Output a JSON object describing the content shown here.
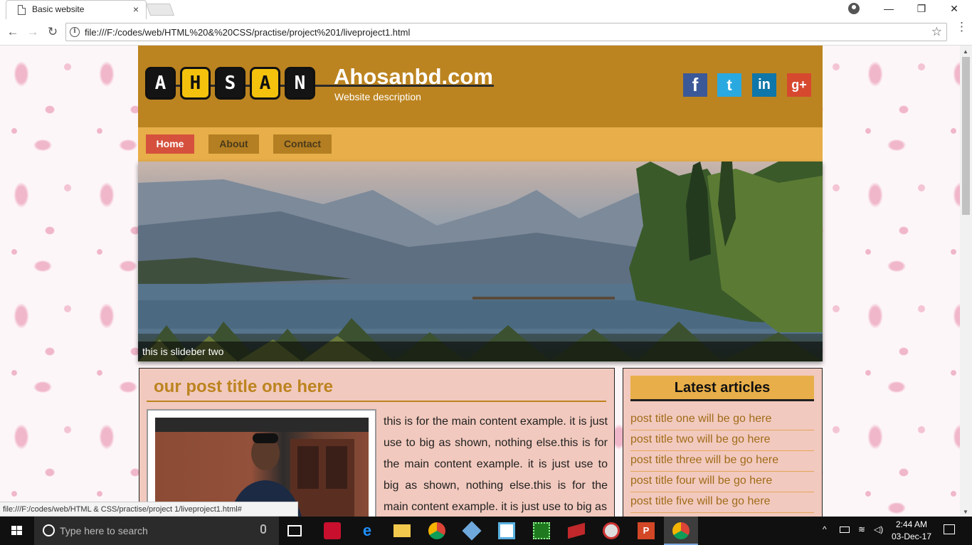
{
  "browser": {
    "tab_title": "Basic website",
    "tab_close": "×",
    "url": "file:///F:/codes/web/HTML%20&%20CSS/practise/project%201/liveproject1.html",
    "status_url": "file:///F:/codes/web/HTML & CSS/practise/project 1/liveproject1.html#",
    "info_glyph": "i",
    "back_glyph": "←",
    "forward_glyph": "→",
    "reload_glyph": "↻",
    "star_glyph": "☆",
    "menu_glyph": "⋮",
    "minimize_glyph": "—",
    "maximize_glyph": "❐",
    "close_glyph": "✕"
  },
  "site": {
    "logo_letters": [
      "A",
      "H",
      "S",
      "A",
      "N"
    ],
    "title": "Ahosanbd.com",
    "description": "Website description",
    "social": [
      {
        "name": "facebook-icon",
        "glyph": "f"
      },
      {
        "name": "twitter-icon",
        "glyph": "t"
      },
      {
        "name": "linkedin-icon",
        "glyph": "in"
      },
      {
        "name": "google-plus-icon",
        "glyph": "g+"
      }
    ],
    "menu": [
      "Home",
      "About",
      "Contact"
    ],
    "slider_caption": "this is slideber two",
    "post": {
      "title": "our post title one here",
      "body": "this is for the main content example. it is just use to big as shown, nothing else.this is for the main content example. it is just use to big as shown, nothing else.this is for the main content example. it is just use to big as"
    },
    "sidebar": {
      "heading": "Latest articles",
      "items": [
        "post title one will be go here",
        "post title two will be go here",
        "post title three will be go here",
        "post title four will be go here",
        "post title five will be go here"
      ]
    }
  },
  "taskbar": {
    "search_placeholder": "Type here to search",
    "time": "2:44 AM",
    "date": "03-Dec-17",
    "apps": [
      "download-manager-icon",
      "edge-icon",
      "file-explorer-icon",
      "chrome-icon",
      "virtualbox-icon",
      "notepadpp-icon",
      "circuit-icon",
      "book-app-icon",
      "paint-icon",
      "powerpoint-icon",
      "chrome-active-icon"
    ]
  },
  "colors": {
    "header": "#bc8420",
    "menubar": "#e8ae49",
    "home_button": "#d5513d",
    "content_bg": "#f2c9be"
  }
}
